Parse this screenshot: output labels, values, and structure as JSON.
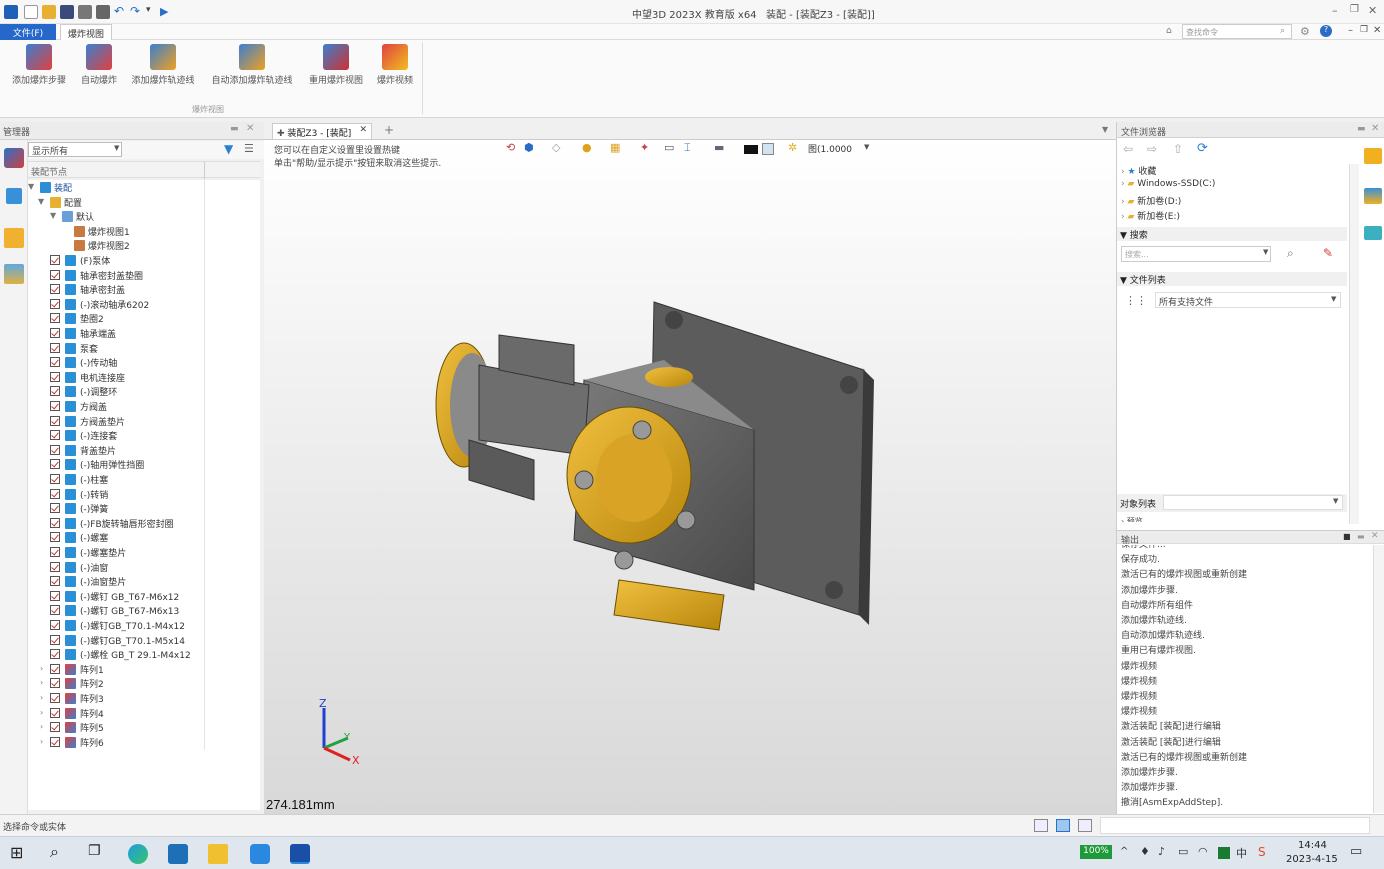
{
  "window": {
    "app_title": "中望3D 2023X 教育版 x64",
    "doc_title": "装配 - [装配Z3 - [装配]]"
  },
  "menu_tabs": [
    "文件(F)",
    "爆炸视图"
  ],
  "search": {
    "placeholder": "查找命令"
  },
  "ribbon": {
    "buttons": [
      "添加爆炸步骤",
      "自动爆炸",
      "添加爆炸轨迹线",
      "自动添加爆炸轨迹线",
      "重用爆炸视图",
      "爆炸视频"
    ],
    "group_label": "爆炸视图"
  },
  "manager": {
    "title": "管理器",
    "filter_value": "显示所有",
    "col_header": "装配节点",
    "root": "装配",
    "config": "配置",
    "default": "默认",
    "views": [
      "爆炸视图1",
      "爆炸视图2"
    ],
    "parts": [
      "(F)泵体",
      "轴承密封盖垫圈",
      "轴承密封盖",
      "(-)滚动轴承6202",
      "垫圈2",
      "轴承端盖",
      "泵套",
      "(-)传动轴",
      "电机连接座",
      "(-)调整环",
      "方阀盖",
      "方阀盖垫片",
      "(-)连接套",
      "背盖垫片",
      "(-)轴用弹性挡圈",
      "(-)柱塞",
      "(-)转销",
      "(-)弹簧",
      "(-)FB旋转轴唇形密封圈",
      "(-)螺塞",
      "(-)螺塞垫片",
      "(-)油窗",
      "(-)油窗垫片",
      "(-)螺钉 GB_T67-M6x12",
      "(-)螺钉 GB_T67-M6x13",
      "(-)螺钉GB_T70.1-M4x12",
      "(-)螺钉GB_T70.1-M5x14",
      "(-)螺栓 GB_T 29.1-M4x12"
    ],
    "arrays": [
      "阵列1",
      "阵列2",
      "阵列3",
      "阵列4",
      "阵列5",
      "阵列6"
    ]
  },
  "doc_tab": {
    "label": "装配Z3 - [装配]",
    "add": "+"
  },
  "viewport": {
    "hint1": "您可以在自定义设置里设置热键",
    "hint2": "单击\"帮助/显示提示\"按钮来取消这些提示.",
    "zoom_value": "图(1.0000",
    "measure": "274.181mm",
    "axis_x": "X",
    "axis_y": "Y",
    "axis_z": "Z"
  },
  "file_browser": {
    "title": "文件浏览器",
    "tree": [
      "收藏",
      "Windows-SSD(C:)",
      "新加卷(D:)",
      "新加卷(E:)"
    ],
    "search_section": "搜索",
    "search_placeholder": "搜索...",
    "file_list_section": "文件列表",
    "file_filter": "所有支持文件",
    "object_list": "对象列表",
    "cut_label": "预览"
  },
  "output": {
    "title": "输出",
    "lines": [
      "保存文件...",
      "保存成功.",
      "激活已有的爆炸视图或重新创建",
      "添加爆炸步骤.",
      "自动爆炸所有组件",
      "添加爆炸轨迹线.",
      "自动添加爆炸轨迹线.",
      "重用已有爆炸视图.",
      "爆炸视频",
      "爆炸视频",
      "爆炸视频",
      "爆炸视频",
      "激活装配 [装配]进行编辑",
      "激活装配 [装配]进行编辑",
      "激活已有的爆炸视图或重新创建",
      "添加爆炸步骤.",
      "添加爆炸步骤.",
      "撤消[AsmExpAddStep]."
    ]
  },
  "status": {
    "prompt": "选择命令或实体"
  },
  "taskbar": {
    "battery": "100%",
    "time": "14:44",
    "date": "2023-4-15"
  }
}
